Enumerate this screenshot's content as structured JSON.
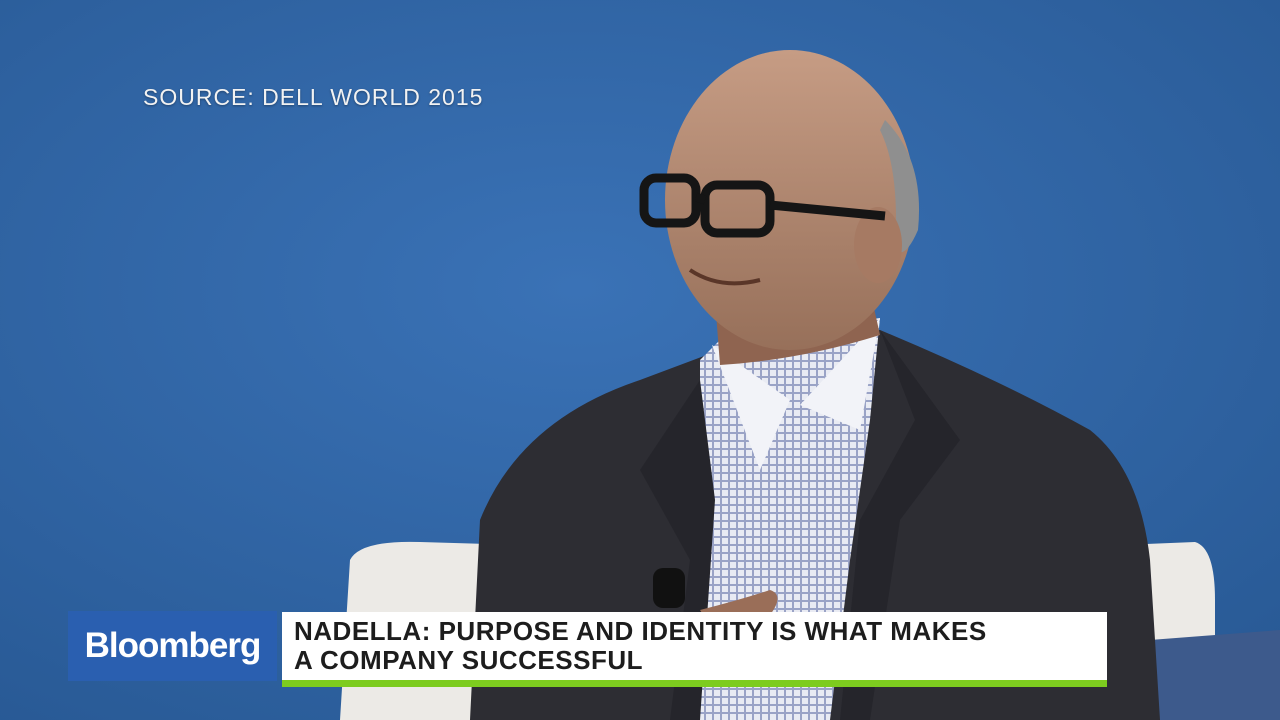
{
  "video": {
    "source_caption": "SOURCE: DELL WORLD 2015"
  },
  "lower_third": {
    "brand": "Bloomberg",
    "headline_line1": "NADELLA: PURPOSE AND IDENTITY IS WHAT MAKES",
    "headline_line2": "A COMPANY SUCCESSFUL"
  },
  "colors": {
    "background_blue": "#2f64a5",
    "brand_blue": "#2a5fb0",
    "accent_green": "#7dcc1f",
    "headline_bg": "#ffffff"
  }
}
